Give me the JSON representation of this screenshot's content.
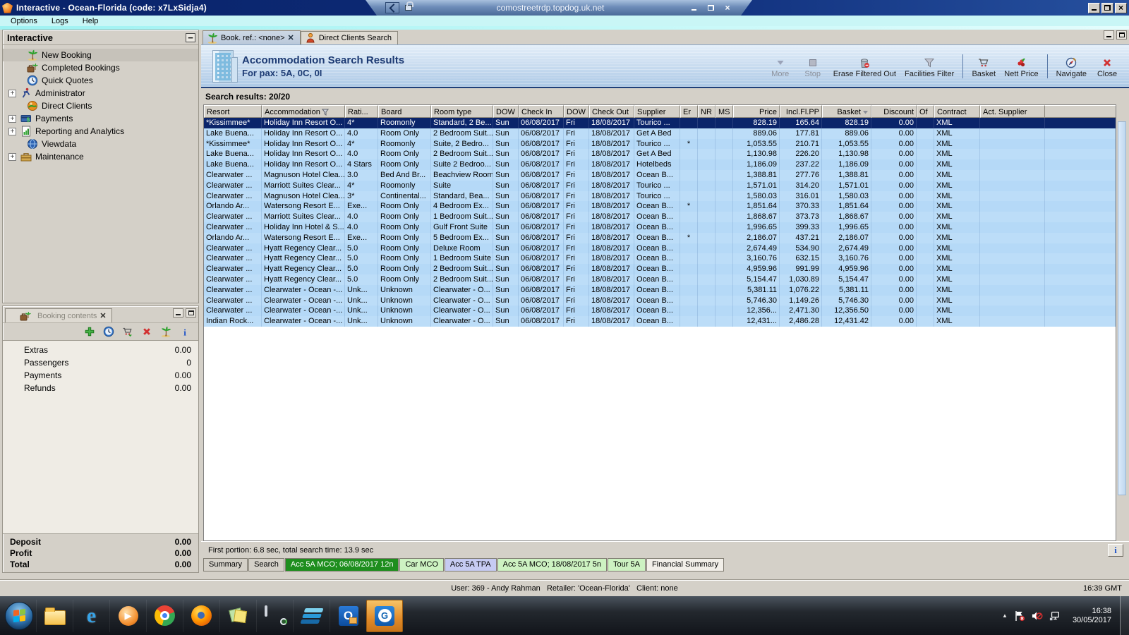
{
  "window": {
    "title": "Interactive - Ocean-Florida (code: x7LxSidja4)"
  },
  "rdp": {
    "host": "comostreetrdp.topdog.uk.net"
  },
  "menu": [
    "Options",
    "Logs",
    "Help"
  ],
  "sidebar": {
    "title": "Interactive",
    "items": [
      {
        "label": "New Booking",
        "icon": "palm",
        "selected": true,
        "expandable": false
      },
      {
        "label": "Completed Bookings",
        "icon": "palmcase",
        "expandable": false
      },
      {
        "label": "Quick Quotes",
        "icon": "clock",
        "expandable": false
      },
      {
        "label": "Administrator",
        "icon": "runner",
        "expandable": true
      },
      {
        "label": "Direct Clients",
        "icon": "clients",
        "expandable": false
      },
      {
        "label": "Payments",
        "icon": "payments",
        "expandable": true
      },
      {
        "label": "Reporting and Analytics",
        "icon": "report",
        "expandable": true
      },
      {
        "label": "Viewdata",
        "icon": "globe",
        "expandable": false
      },
      {
        "label": "Maintenance",
        "icon": "toolbox",
        "expandable": true
      }
    ]
  },
  "booking_panel": {
    "tab_label": "Booking contents",
    "toolbar_icons": [
      "plus",
      "clock",
      "basketarrow",
      "redx",
      "palm",
      "info"
    ],
    "items": [
      {
        "label": "Extras",
        "value": "0.00"
      },
      {
        "label": "Passengers",
        "value": "0"
      },
      {
        "label": "Payments",
        "value": "0.00"
      },
      {
        "label": "Refunds",
        "value": "0.00"
      }
    ],
    "totals": [
      {
        "label": "Deposit",
        "value": "0.00"
      },
      {
        "label": "Profit",
        "value": "0.00"
      },
      {
        "label": "Total",
        "value": "0.00"
      }
    ]
  },
  "main": {
    "tabs": [
      {
        "label": "Book. ref.: <none>",
        "icon": "palm",
        "active": true,
        "closable": true
      },
      {
        "label": "Direct Clients Search",
        "icon": "person",
        "active": false,
        "closable": false
      }
    ],
    "header": {
      "title": "Accommodation Search Results",
      "subtitle": "For pax: 5A, 0C, 0I"
    },
    "toolbar": [
      {
        "label": "More",
        "icon": "more",
        "disabled": true
      },
      {
        "label": "Stop",
        "icon": "stop",
        "disabled": true
      },
      {
        "label": "Erase Filtered Out",
        "icon": "trash"
      },
      {
        "label": "Facilities Filter",
        "icon": "funnel"
      },
      {
        "sep": true
      },
      {
        "label": "Basket",
        "icon": "cart"
      },
      {
        "label": "Nett Price",
        "icon": "nett"
      },
      {
        "sep": true
      },
      {
        "label": "Navigate",
        "icon": "navigate"
      },
      {
        "label": "Close",
        "icon": "closex"
      }
    ],
    "results_label": "Search results: 20/20",
    "portion_text": "First portion: 6.8 sec, total search time: 13.9 sec",
    "info_button": "i",
    "bottom_tabs": [
      {
        "label": "Summary",
        "color": "gray"
      },
      {
        "label": "Search",
        "color": "gray"
      },
      {
        "label": "Acc 5A MCO; 06/08/2017 12n",
        "color": "darkgreen"
      },
      {
        "label": "Car MCO",
        "color": "lightgreen"
      },
      {
        "label": "Acc 5A TPA",
        "color": "lavender"
      },
      {
        "label": "Acc 5A MCO; 18/08/2017 5n",
        "color": "lightgreen"
      },
      {
        "label": "Tour 5A",
        "color": "lightgreen"
      },
      {
        "label": "Financial Summary",
        "color": "white"
      }
    ]
  },
  "table": {
    "columns": [
      {
        "label": "Resort"
      },
      {
        "label": "Accommodation",
        "icon": "filter"
      },
      {
        "label": "Rati..."
      },
      {
        "label": "Board"
      },
      {
        "label": "Room type"
      },
      {
        "label": "DOW"
      },
      {
        "label": "Check In"
      },
      {
        "label": "DOW"
      },
      {
        "label": "Check Out"
      },
      {
        "label": "Supplier"
      },
      {
        "label": "Er"
      },
      {
        "label": "NR"
      },
      {
        "label": "MS"
      },
      {
        "label": "Price",
        "align": "r"
      },
      {
        "label": "Incl.Fl.PP",
        "align": "r"
      },
      {
        "label": "Basket",
        "align": "r",
        "icon": "sort"
      },
      {
        "label": "Discount",
        "align": "r"
      },
      {
        "label": "Of"
      },
      {
        "label": "Contract"
      },
      {
        "label": "Act. Supplier"
      }
    ],
    "selected_row": 0,
    "rows": [
      [
        "*Kissimmee*",
        "Holiday Inn Resort O...",
        "4*",
        "Roomonly",
        "Standard, 2 Be...",
        "Sun",
        "06/08/2017",
        "Fri",
        "18/08/2017",
        "Tourico ...",
        "",
        "",
        "",
        "828.19",
        "165.64",
        "828.19",
        "0.00",
        "",
        "XML",
        ""
      ],
      [
        "Lake Buena...",
        "Holiday Inn Resort O...",
        "4.0",
        "Room Only",
        "2 Bedroom Suit...",
        "Sun",
        "06/08/2017",
        "Fri",
        "18/08/2017",
        "Get A Bed",
        "",
        "",
        "",
        "889.06",
        "177.81",
        "889.06",
        "0.00",
        "",
        "XML",
        ""
      ],
      [
        "*Kissimmee*",
        "Holiday Inn Resort O...",
        "4*",
        "Roomonly",
        "Suite, 2 Bedro...",
        "Sun",
        "06/08/2017",
        "Fri",
        "18/08/2017",
        "Tourico ...",
        "*",
        "",
        "",
        "1,053.55",
        "210.71",
        "1,053.55",
        "0.00",
        "",
        "XML",
        ""
      ],
      [
        "Lake Buena...",
        "Holiday Inn Resort O...",
        "4.0",
        "Room Only",
        "2 Bedroom Suit...",
        "Sun",
        "06/08/2017",
        "Fri",
        "18/08/2017",
        "Get A Bed",
        "",
        "",
        "",
        "1,130.98",
        "226.20",
        "1,130.98",
        "0.00",
        "",
        "XML",
        ""
      ],
      [
        "Lake Buena...",
        "Holiday Inn Resort O...",
        "4 Stars",
        "Room Only",
        "Suite 2 Bedroo...",
        "Sun",
        "06/08/2017",
        "Fri",
        "18/08/2017",
        "Hotelbeds",
        "",
        "",
        "",
        "1,186.09",
        "237.22",
        "1,186.09",
        "0.00",
        "",
        "XML",
        ""
      ],
      [
        "Clearwater ...",
        "Magnuson Hotel Clea...",
        "3.0",
        "Bed And Br...",
        "Beachview Room",
        "Sun",
        "06/08/2017",
        "Fri",
        "18/08/2017",
        "Ocean B...",
        "",
        "",
        "",
        "1,388.81",
        "277.76",
        "1,388.81",
        "0.00",
        "",
        "XML",
        ""
      ],
      [
        "Clearwater ...",
        "Marriott Suites Clear...",
        "4*",
        "Roomonly",
        "Suite",
        "Sun",
        "06/08/2017",
        "Fri",
        "18/08/2017",
        "Tourico ...",
        "",
        "",
        "",
        "1,571.01",
        "314.20",
        "1,571.01",
        "0.00",
        "",
        "XML",
        ""
      ],
      [
        "Clearwater ...",
        "Magnuson Hotel Clea...",
        "3*",
        "Continental...",
        "Standard, Bea...",
        "Sun",
        "06/08/2017",
        "Fri",
        "18/08/2017",
        "Tourico ...",
        "",
        "",
        "",
        "1,580.03",
        "316.01",
        "1,580.03",
        "0.00",
        "",
        "XML",
        ""
      ],
      [
        "Orlando Ar...",
        "Watersong Resort E...",
        "Exe...",
        "Room Only",
        "4 Bedroom Ex...",
        "Sun",
        "06/08/2017",
        "Fri",
        "18/08/2017",
        "Ocean B...",
        "*",
        "",
        "",
        "1,851.64",
        "370.33",
        "1,851.64",
        "0.00",
        "",
        "XML",
        ""
      ],
      [
        "Clearwater ...",
        "Marriott Suites Clear...",
        "4.0",
        "Room Only",
        "1 Bedroom Suit...",
        "Sun",
        "06/08/2017",
        "Fri",
        "18/08/2017",
        "Ocean B...",
        "",
        "",
        "",
        "1,868.67",
        "373.73",
        "1,868.67",
        "0.00",
        "",
        "XML",
        ""
      ],
      [
        "Clearwater ...",
        "Holiday Inn Hotel & S...",
        "4.0",
        "Room Only",
        "Gulf Front Suite",
        "Sun",
        "06/08/2017",
        "Fri",
        "18/08/2017",
        "Ocean B...",
        "",
        "",
        "",
        "1,996.65",
        "399.33",
        "1,996.65",
        "0.00",
        "",
        "XML",
        ""
      ],
      [
        "Orlando Ar...",
        "Watersong Resort E...",
        "Exe...",
        "Room Only",
        "5 Bedroom Ex...",
        "Sun",
        "06/08/2017",
        "Fri",
        "18/08/2017",
        "Ocean B...",
        "*",
        "",
        "",
        "2,186.07",
        "437.21",
        "2,186.07",
        "0.00",
        "",
        "XML",
        ""
      ],
      [
        "Clearwater ...",
        "Hyatt Regency Clear...",
        "5.0",
        "Room Only",
        "Deluxe Room",
        "Sun",
        "06/08/2017",
        "Fri",
        "18/08/2017",
        "Ocean B...",
        "",
        "",
        "",
        "2,674.49",
        "534.90",
        "2,674.49",
        "0.00",
        "",
        "XML",
        ""
      ],
      [
        "Clearwater ...",
        "Hyatt Regency Clear...",
        "5.0",
        "Room Only",
        "1 Bedroom Suite",
        "Sun",
        "06/08/2017",
        "Fri",
        "18/08/2017",
        "Ocean B...",
        "",
        "",
        "",
        "3,160.76",
        "632.15",
        "3,160.76",
        "0.00",
        "",
        "XML",
        ""
      ],
      [
        "Clearwater ...",
        "Hyatt Regency Clear...",
        "5.0",
        "Room Only",
        "2 Bedroom Suit...",
        "Sun",
        "06/08/2017",
        "Fri",
        "18/08/2017",
        "Ocean B...",
        "",
        "",
        "",
        "4,959.96",
        "991.99",
        "4,959.96",
        "0.00",
        "",
        "XML",
        ""
      ],
      [
        "Clearwater ...",
        "Hyatt Regency Clear...",
        "5.0",
        "Room Only",
        "2 Bedroom Suit...",
        "Sun",
        "06/08/2017",
        "Fri",
        "18/08/2017",
        "Ocean B...",
        "",
        "",
        "",
        "5,154.47",
        "1,030.89",
        "5,154.47",
        "0.00",
        "",
        "XML",
        ""
      ],
      [
        "Clearwater ...",
        "Clearwater - Ocean -...",
        "Unk...",
        "Unknown",
        "Clearwater - O...",
        "Sun",
        "06/08/2017",
        "Fri",
        "18/08/2017",
        "Ocean B...",
        "",
        "",
        "",
        "5,381.11",
        "1,076.22",
        "5,381.11",
        "0.00",
        "",
        "XML",
        ""
      ],
      [
        "Clearwater ...",
        "Clearwater - Ocean -...",
        "Unk...",
        "Unknown",
        "Clearwater - O...",
        "Sun",
        "06/08/2017",
        "Fri",
        "18/08/2017",
        "Ocean B...",
        "",
        "",
        "",
        "5,746.30",
        "1,149.26",
        "5,746.30",
        "0.00",
        "",
        "XML",
        ""
      ],
      [
        "Clearwater ...",
        "Clearwater - Ocean -...",
        "Unk...",
        "Unknown",
        "Clearwater - O...",
        "Sun",
        "06/08/2017",
        "Fri",
        "18/08/2017",
        "Ocean B...",
        "",
        "",
        "",
        "12,356...",
        "2,471.30",
        "12,356.50",
        "0.00",
        "",
        "XML",
        ""
      ],
      [
        "Indian Rock...",
        "Clearwater - Ocean -...",
        "Unk...",
        "Unknown",
        "Clearwater - O...",
        "Sun",
        "06/08/2017",
        "Fri",
        "18/08/2017",
        "Ocean B...",
        "",
        "",
        "",
        "12,431...",
        "2,486.28",
        "12,431.42",
        "0.00",
        "",
        "XML",
        ""
      ]
    ]
  },
  "status_bar": {
    "text": "User: 369 - Andy Rahman   Retailer: 'Ocean-Florida'   Client: none",
    "time": "16:39 GMT"
  },
  "taskbar": {
    "icons": [
      "start",
      "explorer",
      "ie",
      "wmp",
      "chrome",
      "firefox",
      "notes",
      "rdp",
      "horizon",
      "outlook",
      "gapp"
    ],
    "active_icon": "gapp",
    "tray_time": "16:38",
    "tray_date": "30/05/2017"
  },
  "colors": {
    "titlebar": "#0a246a",
    "selected_row": "#0a246a",
    "row": "#b5d9f7",
    "active_tab_green": "#1e8e1e",
    "header_text": "#1c3a73"
  }
}
